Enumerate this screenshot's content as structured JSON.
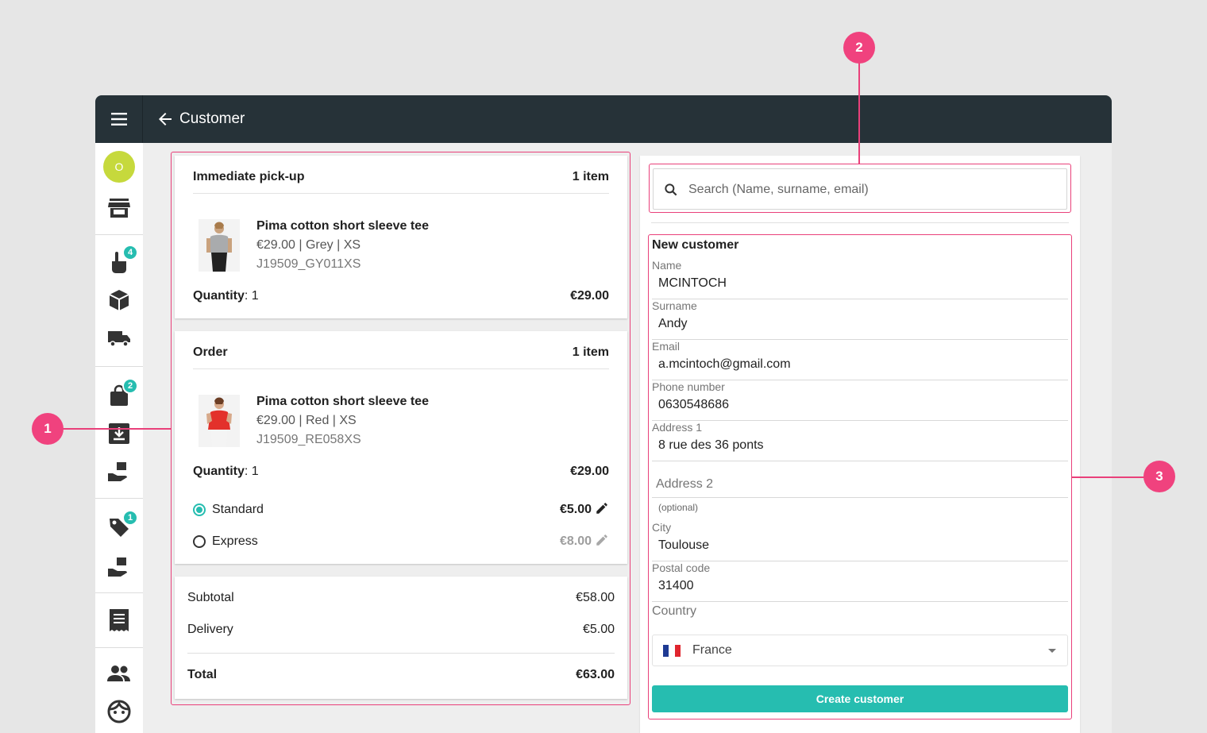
{
  "header": {
    "title": "Customer"
  },
  "sidebar": {
    "avatar_initial": "O",
    "items": [
      {
        "icon": "store-icon"
      },
      {
        "icon": "hand-pointer-icon",
        "badge": "4"
      },
      {
        "icon": "box-icon"
      },
      {
        "icon": "truck-icon"
      },
      {
        "icon": "shopping-bag-icon",
        "badge": "2"
      },
      {
        "icon": "download-box-icon"
      },
      {
        "icon": "hand-package-icon"
      },
      {
        "icon": "tag-icon",
        "badge": "1"
      },
      {
        "icon": "hand-package-icon"
      },
      {
        "icon": "receipt-icon"
      },
      {
        "icon": "people-icon"
      },
      {
        "icon": "face-icon"
      }
    ]
  },
  "cart": {
    "pickup": {
      "title": "Immediate pick-up",
      "count": "1 item",
      "product": {
        "name": "Pima cotton short sleeve tee",
        "meta": "€29.00 | Grey | XS",
        "sku": "J19509_GY011XS"
      },
      "qty_label": "Quantity",
      "qty_value": ": 1",
      "price": "€29.00"
    },
    "order": {
      "title": "Order",
      "count": "1 item",
      "product": {
        "name": "Pima cotton short sleeve tee",
        "meta": "€29.00 | Red | XS",
        "sku": "J19509_RE058XS"
      },
      "qty_label": "Quantity",
      "qty_value": ": 1",
      "price": "€29.00",
      "shipping": [
        {
          "label": "Standard",
          "price": "€5.00",
          "selected": true
        },
        {
          "label": "Express",
          "price": "€8.00",
          "selected": false
        }
      ]
    },
    "summary": {
      "subtotal_label": "Subtotal",
      "subtotal": "€58.00",
      "delivery_label": "Delivery",
      "delivery": "€5.00",
      "total_label": "Total",
      "total": "€63.00"
    }
  },
  "search": {
    "placeholder": "Search (Name, surname, email)"
  },
  "form": {
    "title": "New customer",
    "name": {
      "label": "Name",
      "value": "MCINTOCH"
    },
    "surname": {
      "label": "Surname",
      "value": "Andy"
    },
    "email": {
      "label": "Email",
      "value": "a.mcintoch@gmail.com"
    },
    "phone": {
      "label": "Phone number",
      "value": "0630548686"
    },
    "address1": {
      "label": "Address 1",
      "value": "8 rue des 36 ponts"
    },
    "address2": {
      "placeholder": "Address 2",
      "helper": "(optional)"
    },
    "city": {
      "label": "City",
      "value": "Toulouse"
    },
    "postal": {
      "label": "Postal code",
      "value": "31400"
    },
    "country": {
      "label": "Country",
      "value": "France"
    },
    "submit": "Create customer"
  },
  "callouts": [
    "1",
    "2",
    "3"
  ],
  "colors": {
    "accent": "#26bdb0",
    "header": "#263238",
    "callout": "#f0427e",
    "avatar": "#c6d93c"
  }
}
